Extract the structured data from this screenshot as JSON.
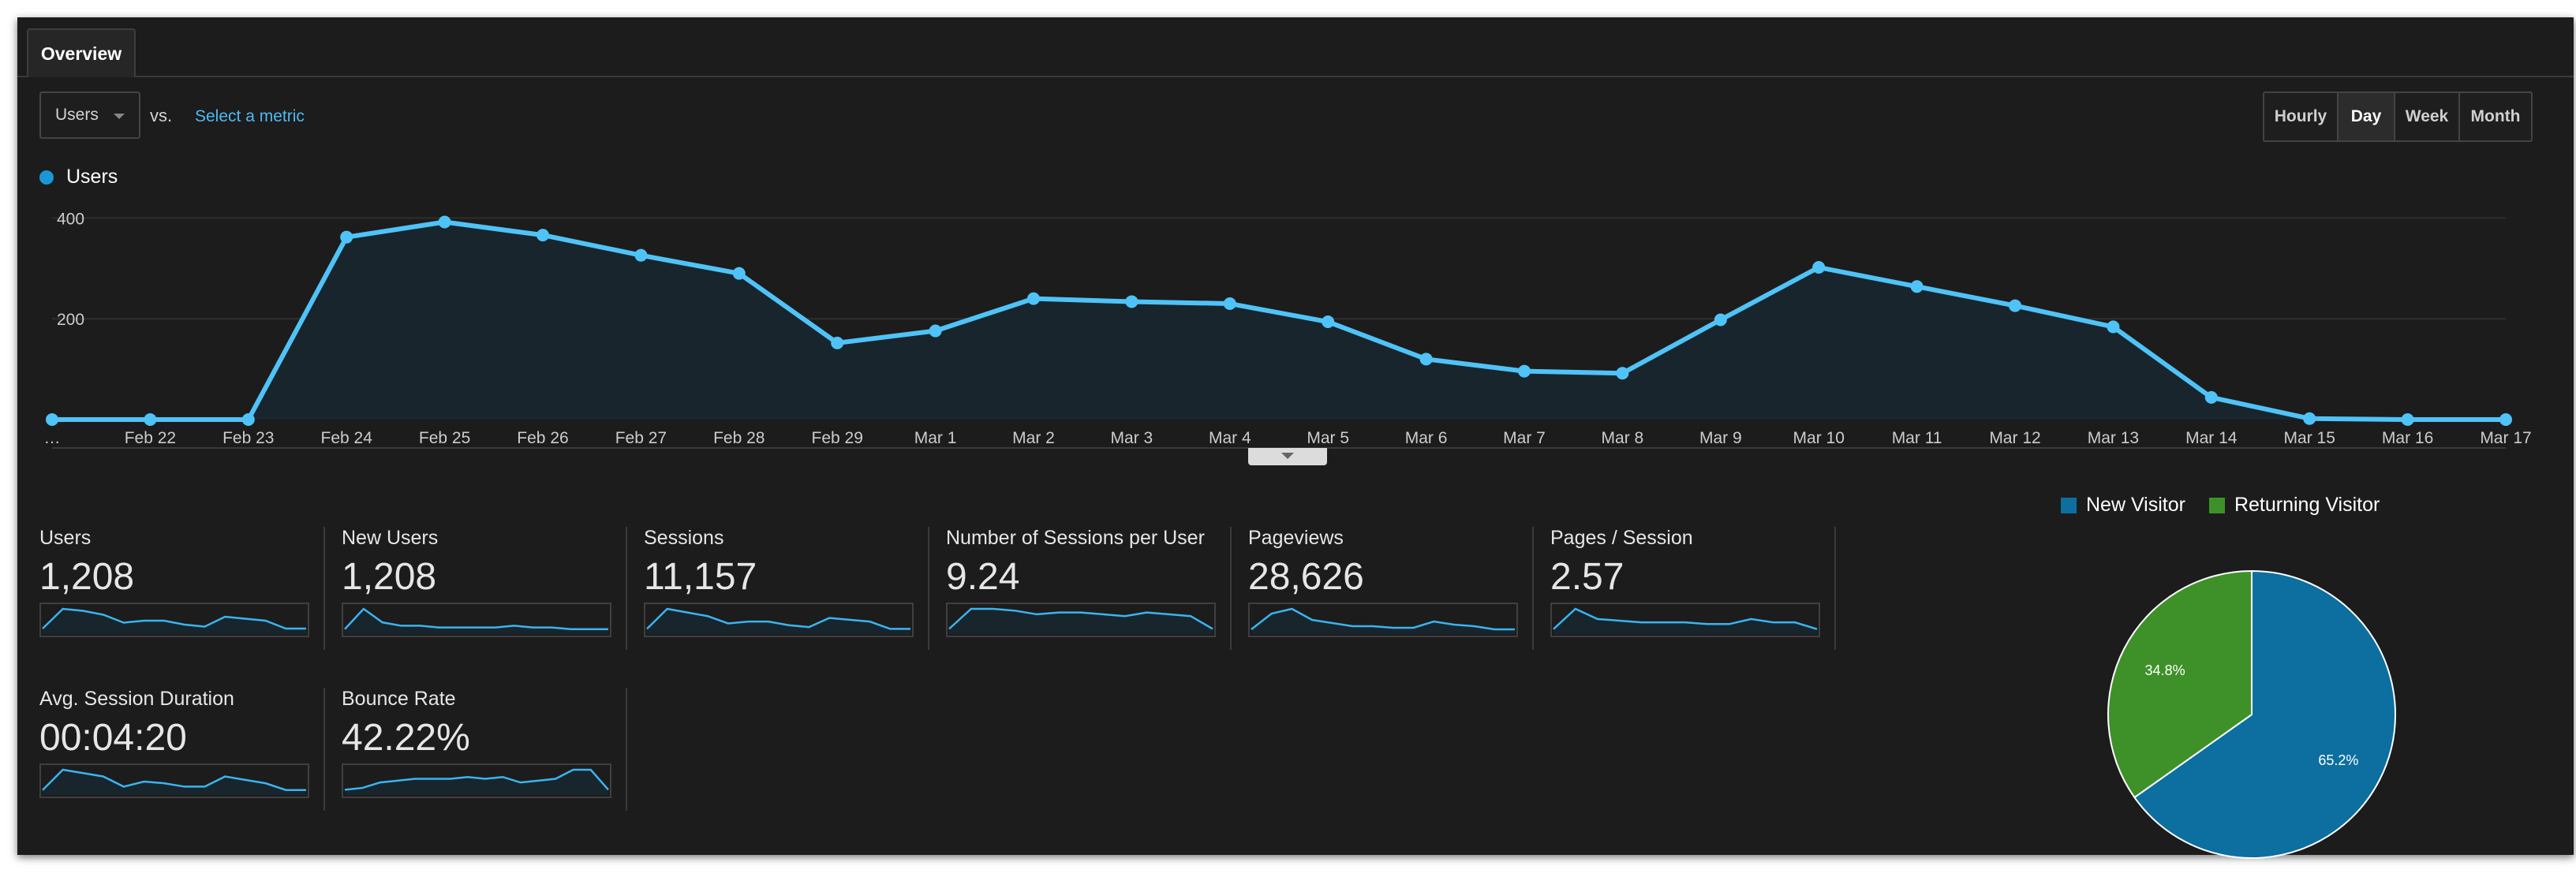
{
  "tabs": [
    {
      "label": "Overview"
    }
  ],
  "controls": {
    "metric_select": "Users",
    "vs_label": "vs.",
    "select_metric_link": "Select a metric",
    "periods": [
      "Hourly",
      "Day",
      "Week",
      "Month"
    ],
    "active_period": "Day"
  },
  "chart_data": [
    {
      "type": "area",
      "series": [
        {
          "name": "Users",
          "color": "#4fc3f7",
          "values": [
            0,
            0,
            0,
            362,
            392,
            366,
            326,
            290,
            152,
            176,
            240,
            234,
            230,
            194,
            120,
            96,
            92,
            198,
            302,
            264,
            226,
            184,
            44,
            2,
            0,
            0
          ]
        }
      ],
      "categories": [
        "…",
        "Feb 22",
        "Feb 23",
        "Feb 24",
        "Feb 25",
        "Feb 26",
        "Feb 27",
        "Feb 28",
        "Feb 29",
        "Mar 1",
        "Mar 2",
        "Mar 3",
        "Mar 4",
        "Mar 5",
        "Mar 6",
        "Mar 7",
        "Mar 8",
        "Mar 9",
        "Mar 10",
        "Mar 11",
        "Mar 12",
        "Mar 13",
        "Mar 14",
        "Mar 15",
        "Mar 16",
        "Mar 17"
      ],
      "y_ticks": [
        "400",
        "200"
      ],
      "ylim": [
        0,
        410
      ],
      "grid": true,
      "legend": "top-left"
    },
    {
      "type": "pie",
      "labels": [
        "New Visitor",
        "Returning Visitor"
      ],
      "values": [
        65.2,
        34.8
      ],
      "value_labels": [
        "65.2%",
        "34.8%"
      ],
      "colors": [
        "#0c6fa0",
        "#3e9129"
      ],
      "legend": "top"
    }
  ],
  "summary": {
    "stats": [
      {
        "name": "Users",
        "value": "1,208",
        "spark": [
          2,
          12,
          11,
          9,
          5,
          6,
          6,
          4,
          3,
          8,
          7,
          6,
          2,
          2
        ]
      },
      {
        "name": "New Users",
        "value": "1,208",
        "spark": [
          2,
          14,
          6,
          4,
          4,
          3,
          3,
          3,
          3,
          4,
          3,
          3,
          2,
          2,
          2
        ]
      },
      {
        "name": "Sessions",
        "value": "11,157",
        "spark": [
          2,
          13,
          11,
          9,
          5,
          6,
          6,
          4,
          3,
          8,
          7,
          6,
          2,
          2
        ]
      },
      {
        "name": "Number of Sessions per User",
        "value": "9.24",
        "spark": [
          2,
          13,
          13,
          12,
          10,
          11,
          11,
          10,
          9,
          11,
          10,
          9,
          2
        ]
      },
      {
        "name": "Pageviews",
        "value": "28,626",
        "spark": [
          2,
          12,
          15,
          8,
          6,
          4,
          4,
          3,
          3,
          7,
          5,
          4,
          2,
          2
        ]
      },
      {
        "name": "Pages / Session",
        "value": "2.57",
        "spark": [
          2,
          14,
          8,
          7,
          6,
          6,
          6,
          5,
          5,
          8,
          6,
          6,
          2
        ]
      },
      {
        "name": "Avg. Session Duration",
        "value": "00:04:20",
        "spark": [
          2,
          14,
          12,
          10,
          4,
          7,
          6,
          4,
          4,
          10,
          8,
          6,
          2,
          2
        ]
      },
      {
        "name": "Bounce Rate",
        "value": "42.22%",
        "spark": [
          2,
          3,
          6,
          7,
          8,
          8,
          8,
          9,
          8,
          9,
          6,
          7,
          8,
          13,
          13,
          2
        ]
      }
    ]
  },
  "colors": {
    "panel_bg": "#1c1c1c",
    "line": "#4fc3f7",
    "accent_link": "#4fb8f3"
  }
}
